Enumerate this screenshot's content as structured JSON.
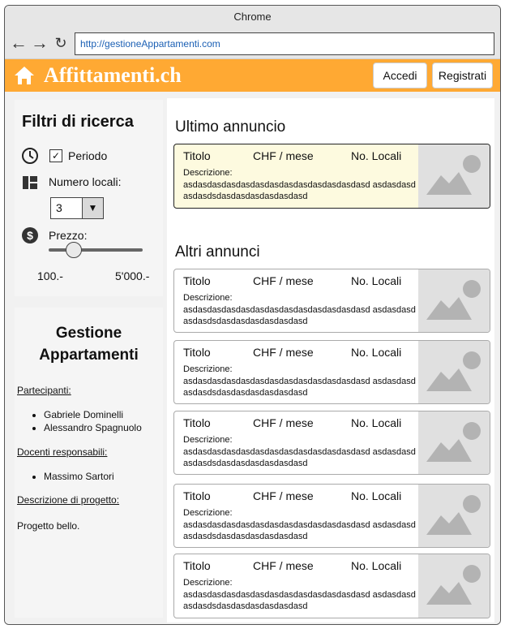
{
  "browser": {
    "title": "Chrome",
    "url": "http://gestioneAppartamenti.com"
  },
  "header": {
    "brand": "Affittamenti.ch",
    "login_label": "Accedi",
    "register_label": "Registrati",
    "bg_color": "#ffa933"
  },
  "filters": {
    "title": "Filtri di ricerca",
    "period_label": "Periodo",
    "period_checked": true,
    "rooms_label": "Numero locali:",
    "rooms_value": "3",
    "price_label": "Prezzo:",
    "price_min": "100.-",
    "price_max": "5'000.-",
    "slider_level": 0.27
  },
  "info": {
    "title": "Gestione Appartamenti",
    "participants_label": "Partecipanti:",
    "participants": [
      "Gabriele Dominelli",
      "Alessandro Spagnuolo"
    ],
    "teachers_label": "Docenti responsabili:",
    "teachers": [
      "Massimo Sartori"
    ],
    "description_label": "Descrizione di progetto:",
    "description": "Progetto bello."
  },
  "latest": {
    "section_title": "Ultimo annuncio",
    "card": {
      "title": "Titolo",
      "price": "CHF / mese",
      "rooms": "No. Locali",
      "desc_label": "Descrizione:",
      "desc": "asdasdasdasdasdasdasdasdasdasdasdasdasd asdasdasdasdasdsdasdasdasdasdasdasd"
    }
  },
  "others": {
    "section_title": "Altri annunci",
    "cards": [
      {
        "title": "Titolo",
        "price": "CHF / mese",
        "rooms": "No. Locali",
        "desc_label": "Descrizione:",
        "desc": "asdasdasdasdasdasdasdasdasdasdasdasdasd asdasdasdasdasdsdasdasdasdasdasdasd"
      },
      {
        "title": "Titolo",
        "price": "CHF / mese",
        "rooms": "No. Locali",
        "desc_label": "Descrizione:",
        "desc": "asdasdasdasdasdasdasdasdasdasdasdasdasd asdasdasdasdasdsdasdasdasdasdasdasd"
      },
      {
        "title": "Titolo",
        "price": "CHF / mese",
        "rooms": "No. Locali",
        "desc_label": "Descrizione:",
        "desc": "asdasdasdasdasdasdasdasdasdasdasdasdasd asdasdasdasdasdsdasdasdasdasdasdasd"
      },
      {
        "title": "Titolo",
        "price": "CHF / mese",
        "rooms": "No. Locali",
        "desc_label": "Descrizione:",
        "desc": "asdasdasdasdasdasdasdasdasdasdasdasdasd asdasdasdasdasdsdasdasdasdasdasdasd"
      },
      {
        "title": "Titolo",
        "price": "CHF / mese",
        "rooms": "No. Locali",
        "desc_label": "Descrizione:",
        "desc": "asdasdasdasdasdasdasdasdasdasdasdasdasd asdasdasdasdasdsdasdasdasdasdasdasd"
      }
    ]
  }
}
